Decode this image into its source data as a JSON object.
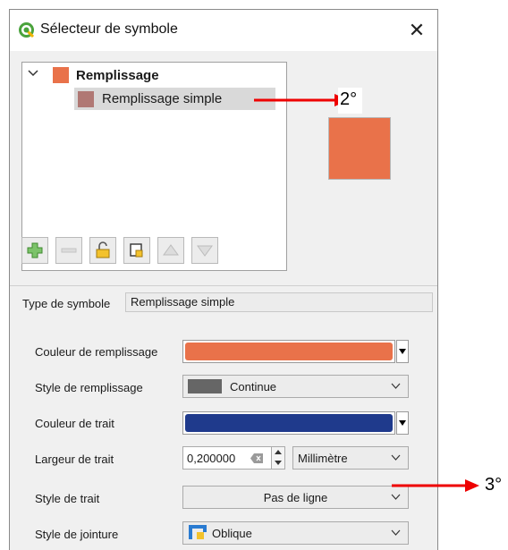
{
  "dialog": {
    "title": "Sélecteur de symbole",
    "close_glyph": "✕"
  },
  "tree": {
    "root": {
      "label": "Remplissage",
      "swatch_color": "#e9724a",
      "expanded": true
    },
    "child": {
      "label": "Remplissage simple",
      "swatch_color": "#b07874",
      "selected": true
    }
  },
  "preview": {
    "color": "#e9724a"
  },
  "toolbar": {
    "buttons": [
      "add-layer-icon",
      "remove-layer-icon",
      "lock-icon",
      "duplicate-layer-icon",
      "move-up-icon",
      "move-down-icon"
    ]
  },
  "symbol_type": {
    "label": "Type de symbole",
    "value": "Remplissage simple"
  },
  "properties": {
    "fill_color": {
      "label": "Couleur de remplissage",
      "color": "#e9724a"
    },
    "fill_style": {
      "label": "Style de remplissage",
      "value": "Continue",
      "swatch_color": "#666666"
    },
    "stroke_color": {
      "label": "Couleur de trait",
      "color": "#1f3a8c"
    },
    "stroke_width": {
      "label": "Largeur de trait",
      "value": "0,200000",
      "unit": "Millimètre"
    },
    "stroke_style": {
      "label": "Style de trait",
      "value": "Pas de ligne"
    },
    "join_style": {
      "label": "Style de jointure",
      "value": "Oblique"
    }
  },
  "annotations": {
    "a2": {
      "label": "2°",
      "color": "#ee0000"
    },
    "a3": {
      "label": "3°",
      "color": "#ee0000"
    }
  }
}
